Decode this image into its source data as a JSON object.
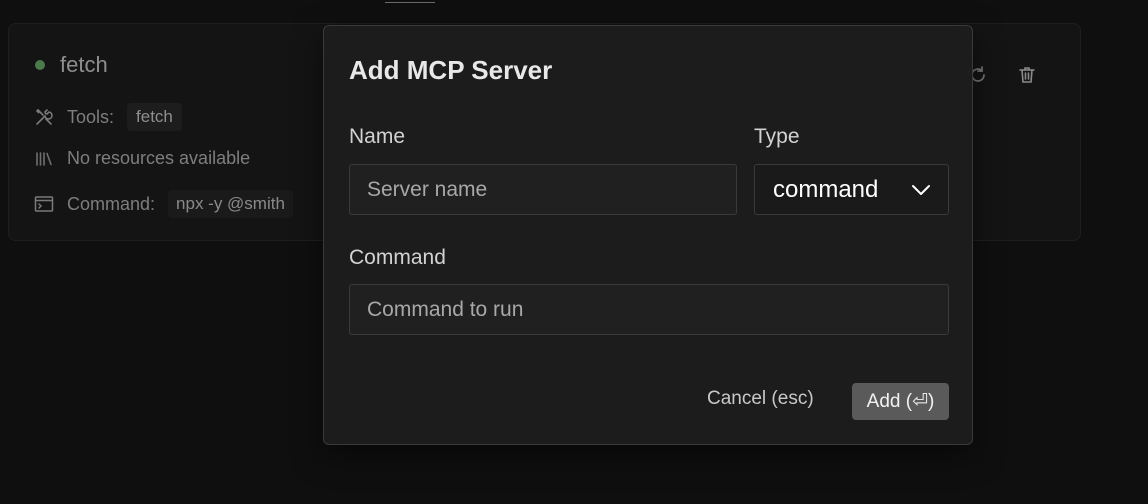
{
  "server_card": {
    "name": "fetch",
    "status": "running",
    "tools_label": "Tools:",
    "tools": [
      "fetch"
    ],
    "resources_text": "No resources available",
    "command_label": "Command:",
    "command_value": "npx -y @smith"
  },
  "dialog": {
    "title": "Add MCP Server",
    "name_label": "Name",
    "name_placeholder": "Server name",
    "name_value": "",
    "type_label": "Type",
    "type_value": "command",
    "command_label": "Command",
    "command_placeholder": "Command to run",
    "command_value": "",
    "cancel_label": "Cancel (esc)",
    "add_label": "Add (⏎)"
  },
  "colors": {
    "status_running": "#4c7a4c",
    "add_button_bg": "#5a5a5a",
    "dialog_bg": "#1c1c1c"
  },
  "icons": {
    "tools": "tools-icon",
    "resources": "library-icon",
    "command": "terminal-icon",
    "refresh": "refresh-icon",
    "delete": "trash-icon",
    "select": "chevron-down-icon"
  }
}
